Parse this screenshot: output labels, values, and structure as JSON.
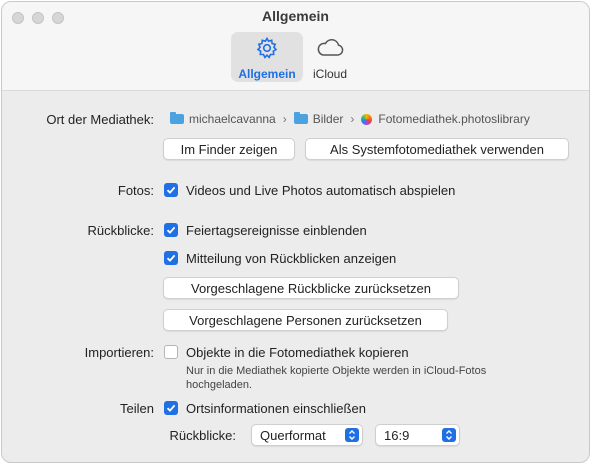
{
  "window": {
    "title": "Allgemein"
  },
  "tabs": [
    {
      "label": "Allgemein",
      "icon": "gear-icon",
      "active": true
    },
    {
      "label": "iCloud",
      "icon": "cloud-icon",
      "active": false
    }
  ],
  "library": {
    "label": "Ort der Mediathek:",
    "path": [
      "michaelcavanna",
      "Bilder",
      "Fotomediathek.photoslibrary"
    ],
    "buttons": {
      "finder": "Im Finder zeigen",
      "system": "Als Systemfotomediathek verwenden"
    }
  },
  "photos": {
    "label": "Fotos:",
    "autoplay": {
      "text": "Videos und Live Photos automatisch abspielen",
      "checked": true
    }
  },
  "memories": {
    "label": "Rückblicke:",
    "holidays": {
      "text": "Feiertagsereignisse einblenden",
      "checked": true
    },
    "notify": {
      "text": "Mitteilung von Rückblicken anzeigen",
      "checked": true
    },
    "reset_memories": "Vorgeschlagene Rückblicke zurücksetzen",
    "reset_people": "Vorgeschlagene Personen zurücksetzen"
  },
  "import": {
    "label": "Importieren:",
    "copy": {
      "text": "Objekte in die Fotomediathek kopieren",
      "checked": false
    },
    "note_line1": "Nur in die Mediathek kopierte Objekte werden in iCloud-Fotos",
    "note_line2": "hochgeladen."
  },
  "share": {
    "label": "Teilen",
    "location": {
      "text": "Ortsinformationen einschließen",
      "checked": true
    },
    "memories_label": "Rückblicke:",
    "format_value": "Querformat",
    "ratio_value": "16:9"
  },
  "colors": {
    "accent": "#1f6fe5"
  }
}
